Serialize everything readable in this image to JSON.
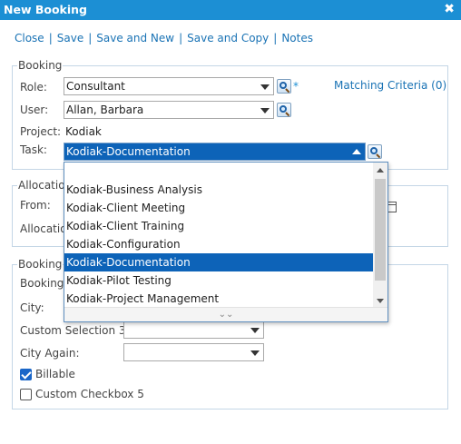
{
  "window": {
    "title": "New Booking",
    "close_glyph": "✖"
  },
  "toolbar": {
    "close": "Close",
    "save": "Save",
    "save_and_new": "Save and New",
    "save_and_copy": "Save and Copy",
    "notes": "Notes",
    "separator": "|"
  },
  "booking": {
    "legend": "Booking",
    "role_label": "Role:",
    "role_value": "Consultant",
    "required_marker": "*",
    "matching_criteria": "Matching Criteria (0)",
    "user_label": "User:",
    "user_value": "Allan, Barbara",
    "project_label": "Project:",
    "project_value": "Kodiak",
    "task_label": "Task:",
    "task_value": "Kodiak-Documentation"
  },
  "allocation": {
    "legend": "Allocatio",
    "from_label": "From:",
    "allocation_label": "Allocatio"
  },
  "booking_details": {
    "legend": "Booking",
    "row1_label": "Booking",
    "city_label": "City:",
    "custom_selection_label": "Custom Selection 3:",
    "custom_selection_value": "",
    "city_again_label": "City Again:",
    "city_again_value": "",
    "billable_label": "Billable",
    "billable_checked": true,
    "custom_checkbox_label": "Custom Checkbox 5",
    "custom_checkbox_checked": false
  },
  "task_dropdown": {
    "options": [
      "",
      "Kodiak-Business Analysis",
      "Kodiak-Client Meeting",
      "Kodiak-Client Training",
      "Kodiak-Configuration",
      "Kodiak-Documentation",
      "Kodiak-Pilot Testing",
      "Kodiak-Project Management"
    ],
    "selected": "Kodiak-Documentation",
    "more_glyph": "⌄⌄"
  },
  "icons": {
    "lookup": "search-lookup-icon",
    "calendar": "calendar-icon",
    "close": "close-icon"
  },
  "colors": {
    "titlebar": "#1c8fd4",
    "link": "#1a73b5",
    "selection": "#0d63b8",
    "border": "#c4d6e6"
  }
}
